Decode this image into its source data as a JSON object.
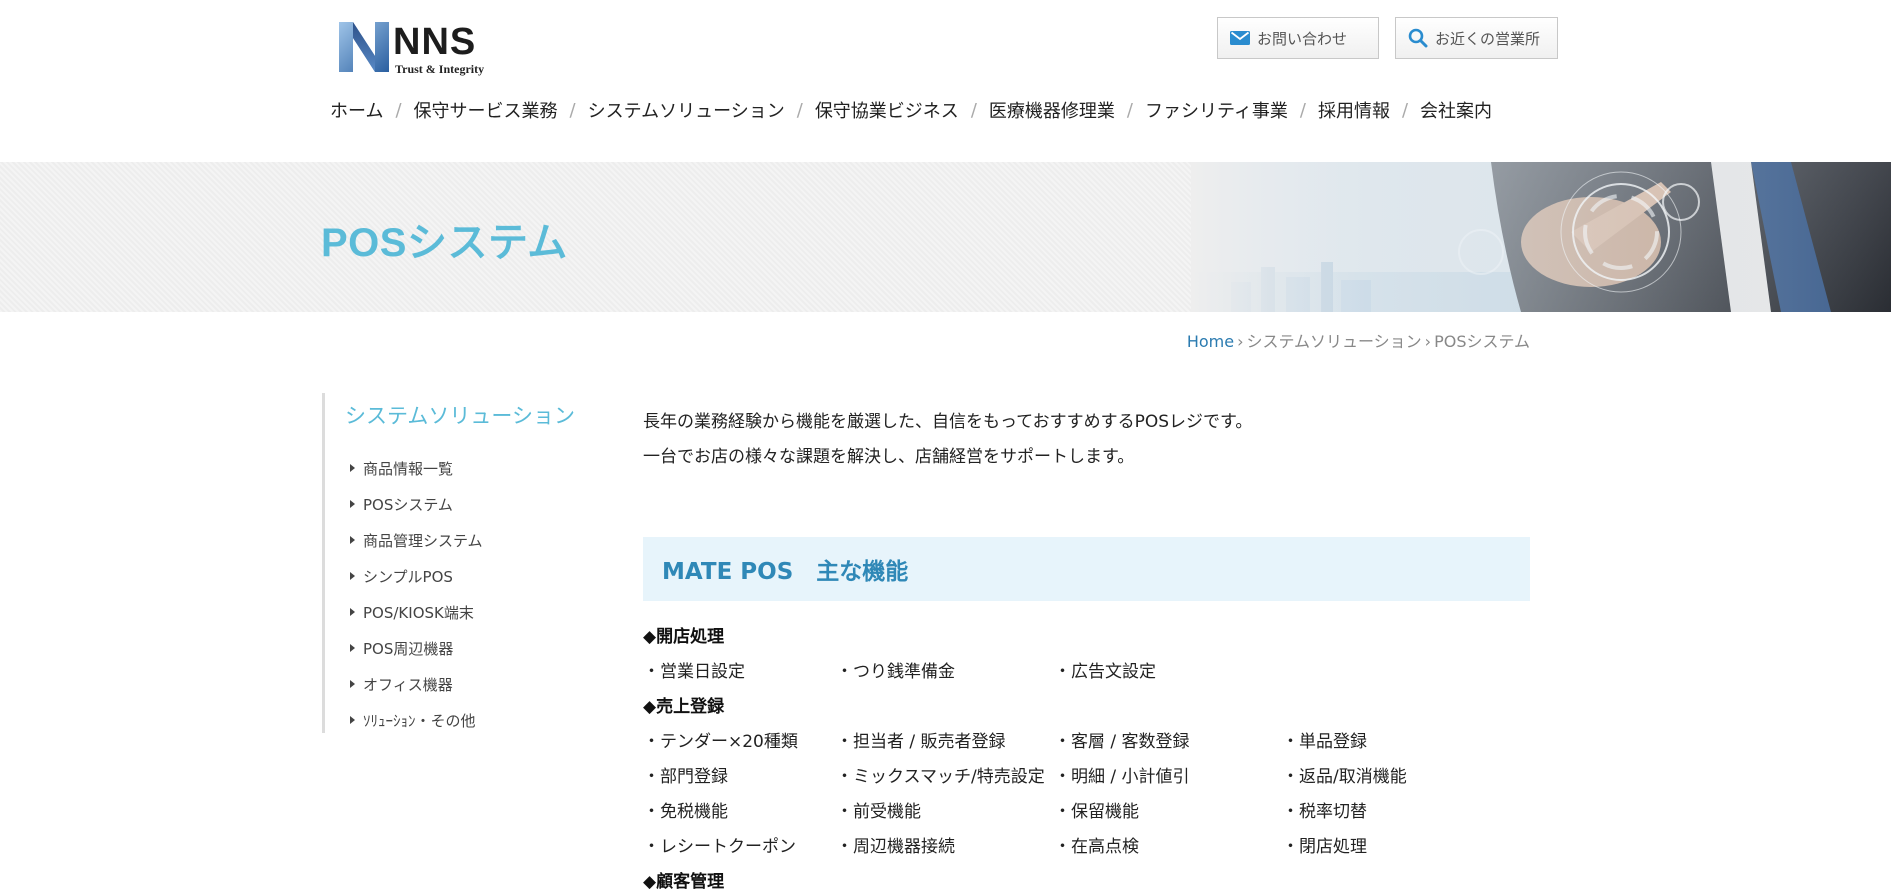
{
  "header": {
    "logo": {
      "name": "NNS",
      "tagline": "Trust & Integrity"
    },
    "buttons": {
      "contact": "お問い合わせ",
      "office": "お近くの営業所"
    },
    "nav": [
      "ホーム",
      "保守サービス業務",
      "システムソリューション",
      "保守協業ビジネス",
      "医療機器修理業",
      "ファシリティ事業",
      "採用情報",
      "会社案内"
    ],
    "nav_separator": "/"
  },
  "banner": {
    "title": "POSシステム"
  },
  "breadcrumb": {
    "home": "Home",
    "parent": "システムソリューション",
    "current": "POSシステム",
    "arrow": "›"
  },
  "sidebar": {
    "title": "システムソリューション",
    "items": [
      "商品情報一覧",
      "POSシステム",
      "商品管理システム",
      "シンプルPOS",
      "POS/KIOSK端末",
      "POS周辺機器",
      "オフィス機器",
      "ｿﾘｭｰｼｮﾝ・その他"
    ]
  },
  "main": {
    "intro": [
      "長年の業務経験から機能を厳選した、自信をもっておすすめするPOSレジです。",
      "一台でお店の様々な課題を解決し、店舗経営をサポートします。"
    ],
    "feature_heading": "MATE POS　主な機能",
    "categories": [
      {
        "title": "◆開店処理",
        "rows": [
          [
            "・営業日設定",
            "・つり銭準備金",
            "・広告文設定",
            ""
          ]
        ]
      },
      {
        "title": "◆売上登録",
        "rows": [
          [
            "・テンダー×20種類",
            "・担当者 / 販売者登録",
            "・客層 / 客数登録",
            "・単品登録"
          ],
          [
            "・部門登録",
            "・ミックスマッチ/特売設定",
            "・明細 / 小計値引",
            "・返品/取消機能"
          ],
          [
            "・免税機能",
            "・前受機能",
            "・保留機能",
            "・税率切替"
          ],
          [
            "・レシートクーポン",
            "・周辺機器接続",
            "・在高点検",
            "・閉店処理"
          ]
        ]
      },
      {
        "title": "◆顧客管理",
        "rows": []
      }
    ]
  },
  "colors": {
    "accent": "#5bbbd8",
    "link": "#2b7bb0",
    "feature_bg": "#e7f4fb",
    "feature_text": "#2f88b7"
  },
  "icons": {
    "contact": "mail-icon",
    "office": "search-icon"
  }
}
